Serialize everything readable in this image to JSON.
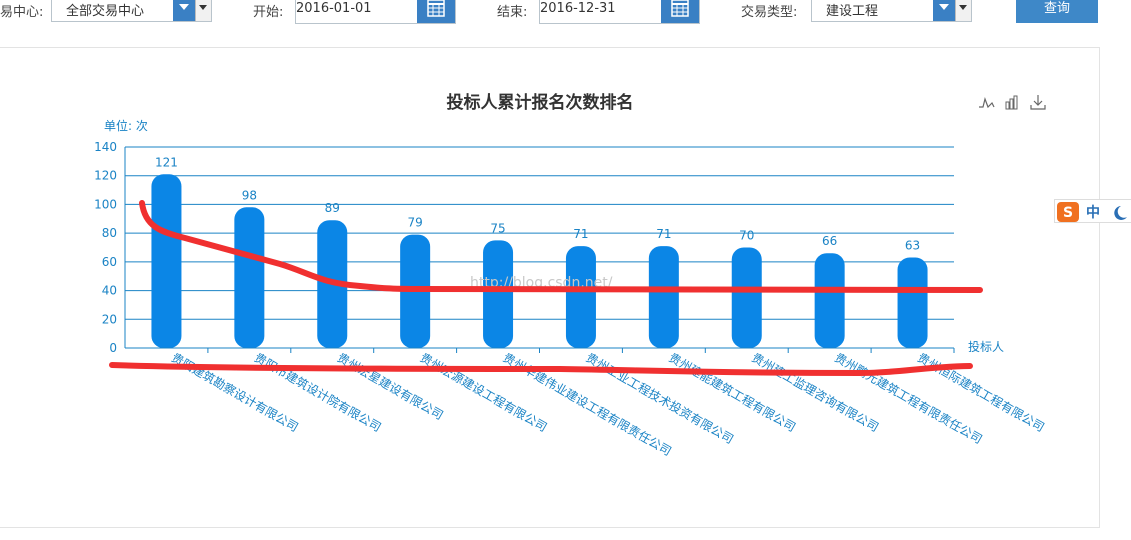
{
  "filters": {
    "center_label": "易中心:",
    "center_value": "全部交易中心",
    "start_label": "开始:",
    "start_value": "2016-01-01",
    "end_label": "结束:",
    "end_value": "2016-12-31",
    "type_label": "交易类型:",
    "type_value": "建设工程",
    "query_label": "查询"
  },
  "ime": {
    "mode_label": "中"
  },
  "watermark": "http://blog.csdn.net/",
  "chart_data": {
    "type": "bar",
    "title": "投标人累计报名次数排名",
    "unit_label": "单位: 次",
    "xlabel": "投标人",
    "ylim": [
      0,
      140
    ],
    "yticks": [
      0,
      20,
      40,
      60,
      80,
      100,
      120,
      140
    ],
    "grid": true,
    "bar_color": "#0b86e6",
    "accent_color": "#1a83c5",
    "annotation_color": "#f03030",
    "categories": [
      "贵阳建筑勘察设计有限公司",
      "贵阳市建筑设计院有限公司",
      "贵州宏星建设有限公司",
      "贵州宏源建设工程有限公司",
      "贵州华建伟业建设工程有限责任公司",
      "贵州工业工程技术投资有限公司",
      "贵州建能建筑工程有限公司",
      "贵州建工监理咨询有限公司",
      "贵州鹏元建筑工程有限责任公司",
      "贵州恒际建筑工程有限公司"
    ],
    "values": [
      121,
      98,
      89,
      79,
      75,
      71,
      71,
      70,
      66,
      63
    ]
  }
}
